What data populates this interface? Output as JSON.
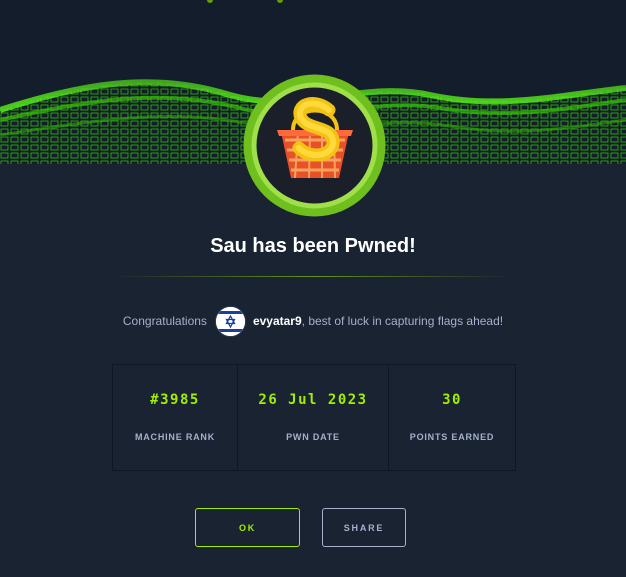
{
  "dialog": {
    "title": "Sau has been Pwned!",
    "congrats_prefix": "Congratulations",
    "username": "evyatar9",
    "congrats_suffix": ", best of luck in capturing flags ahead!"
  },
  "stats": [
    {
      "value": "#3985",
      "label": "MACHINE RANK"
    },
    {
      "value": "26 Jul 2023",
      "label": "PWN DATE"
    },
    {
      "value": "30",
      "label": "POINTS EARNED"
    }
  ],
  "buttons": {
    "ok_label": "OK",
    "share_label": "SHARE"
  },
  "colors": {
    "accent": "#9fef00",
    "background": "#1a2332",
    "muted_text": "#a4b1cd"
  },
  "icons": {
    "machine_logo": "sau-basket-logo",
    "user_flag": "israel-flag-avatar"
  }
}
